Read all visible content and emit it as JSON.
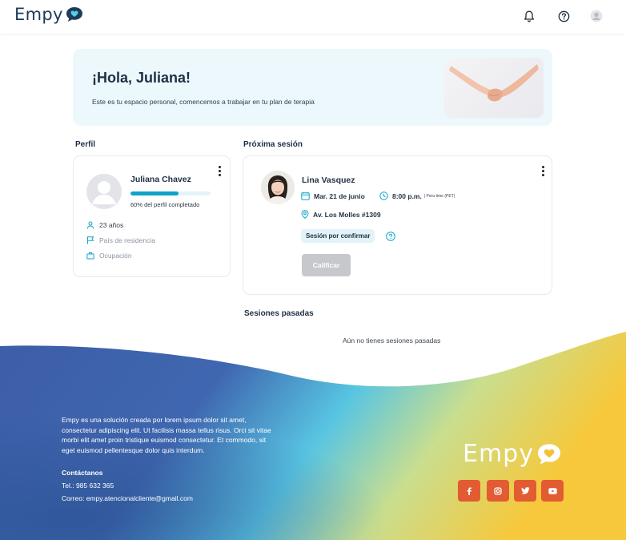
{
  "header": {
    "logo_text": "Empy",
    "icons": [
      "bell-icon",
      "help-circle-icon",
      "user-avatar-icon"
    ]
  },
  "greeting": {
    "title": "¡Hola, Juliana!",
    "subtitle": "Este es tu espacio personal, comencemos a trabajar en tu plan de terapia"
  },
  "profile": {
    "section_title": "Perfil",
    "name": "Juliana Chavez",
    "progress_label": "60% del perfil completado",
    "progress_fraction": 0.6,
    "age": "23 años",
    "country": "País de residencia",
    "occupation": "Ocupación"
  },
  "next_session": {
    "section_title": "Próxima sesión",
    "therapist": "Lina Vasquez",
    "date": "Mar. 21 de junio",
    "time": "8:00 p.m.",
    "timezone": "| Peru time (PET)",
    "address": "Av. Los Molles #1309",
    "status": "Sesión por confirmar",
    "rate_button": "Calificar"
  },
  "past_sessions": {
    "section_title": "Sesiones pasadas",
    "empty_message": "Aún no tienes sesiones pasadas"
  },
  "footer": {
    "description_lines": [
      "Empy es una solución creada por lorem ipsum dolor sit amet,",
      "consectetur adipiscing elit. Ut facilisis massa tellus risus. Orci sit vitae",
      "morbi elit amet proin tristique euismod consectetur. Et commodo, sit",
      "eget euismod pellentesque dolor quis interdum."
    ],
    "contact_title": "Contáctanos",
    "phone": "Tel.: 985 632 365",
    "email": "Correo: empy.atencionalcliente@gmail.com",
    "logo_text": "Empy",
    "social_icons": [
      "facebook-icon",
      "instagram-icon",
      "twitter-icon",
      "youtube-icon"
    ]
  },
  "colors": {
    "accent": "#0fa3c9",
    "brand_dark": "#1f3a5a",
    "banner_bg": "#ecf8fb",
    "social_orange": "#e35b32",
    "logo_yellow": "#f5bf3a"
  }
}
